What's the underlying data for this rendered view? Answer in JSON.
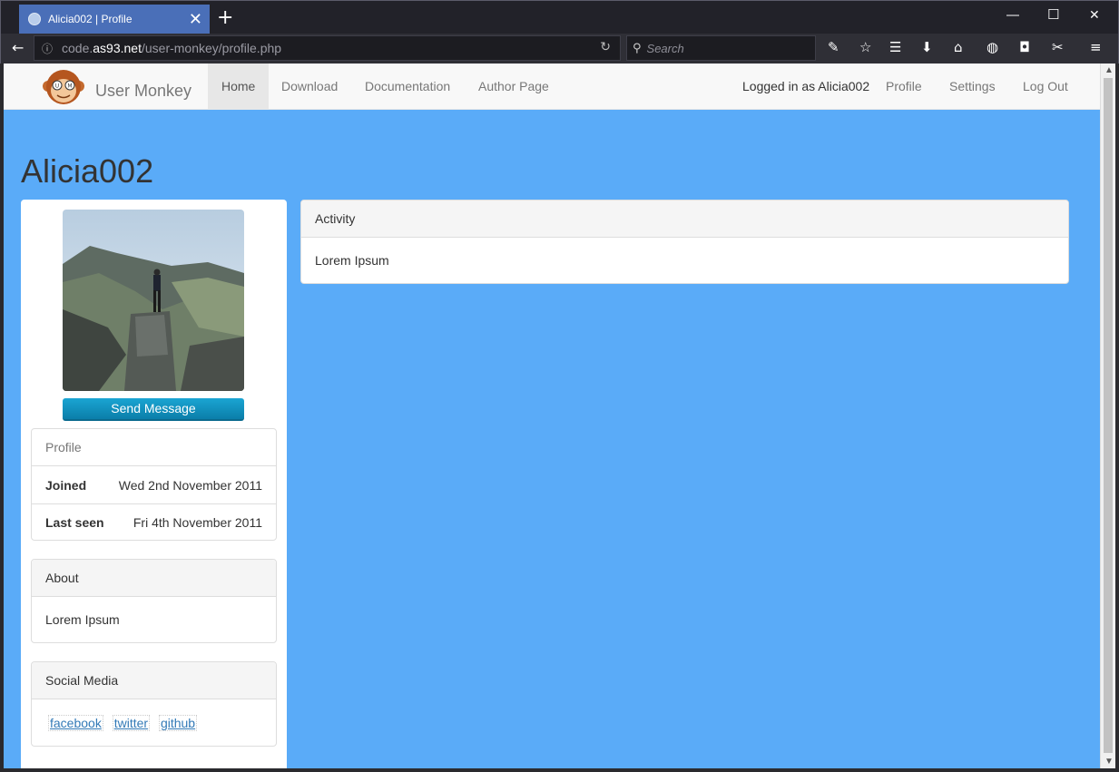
{
  "browser": {
    "tab_title": "Alicia002 | Profile",
    "url_prefix": "code.",
    "url_domain": "as93.net",
    "url_path": "/user-monkey/profile.php",
    "search_placeholder": "Search",
    "new_tab_symbol": "+",
    "close_tab_symbol": "✕"
  },
  "site": {
    "brand": "User Monkey",
    "nav": [
      "Home",
      "Download",
      "Documentation",
      "Author Page"
    ],
    "active_nav": "Home",
    "logged_in_text": "Logged in as Alicia002",
    "right_nav": [
      "Profile",
      "Settings",
      "Log Out"
    ]
  },
  "profile": {
    "username": "Alicia002",
    "send_message": "Send Message",
    "info_title": "Profile",
    "joined_label": "Joined",
    "joined_value": "Wed 2nd November 2011",
    "last_seen_label": "Last seen",
    "last_seen_value": "Fri 4th November 2011",
    "about_title": "About",
    "about_text": "Lorem Ipsum",
    "social_title": "Social Media",
    "social_links": [
      "facebook",
      "twitter",
      "github"
    ]
  },
  "activity": {
    "title": "Activity",
    "text": "Lorem Ipsum"
  },
  "colors": {
    "page_bg": "#5aabf8",
    "tab_active": "#4a6fb8",
    "button_gradient_top": "#1aa5d3",
    "link": "#337ab7"
  }
}
